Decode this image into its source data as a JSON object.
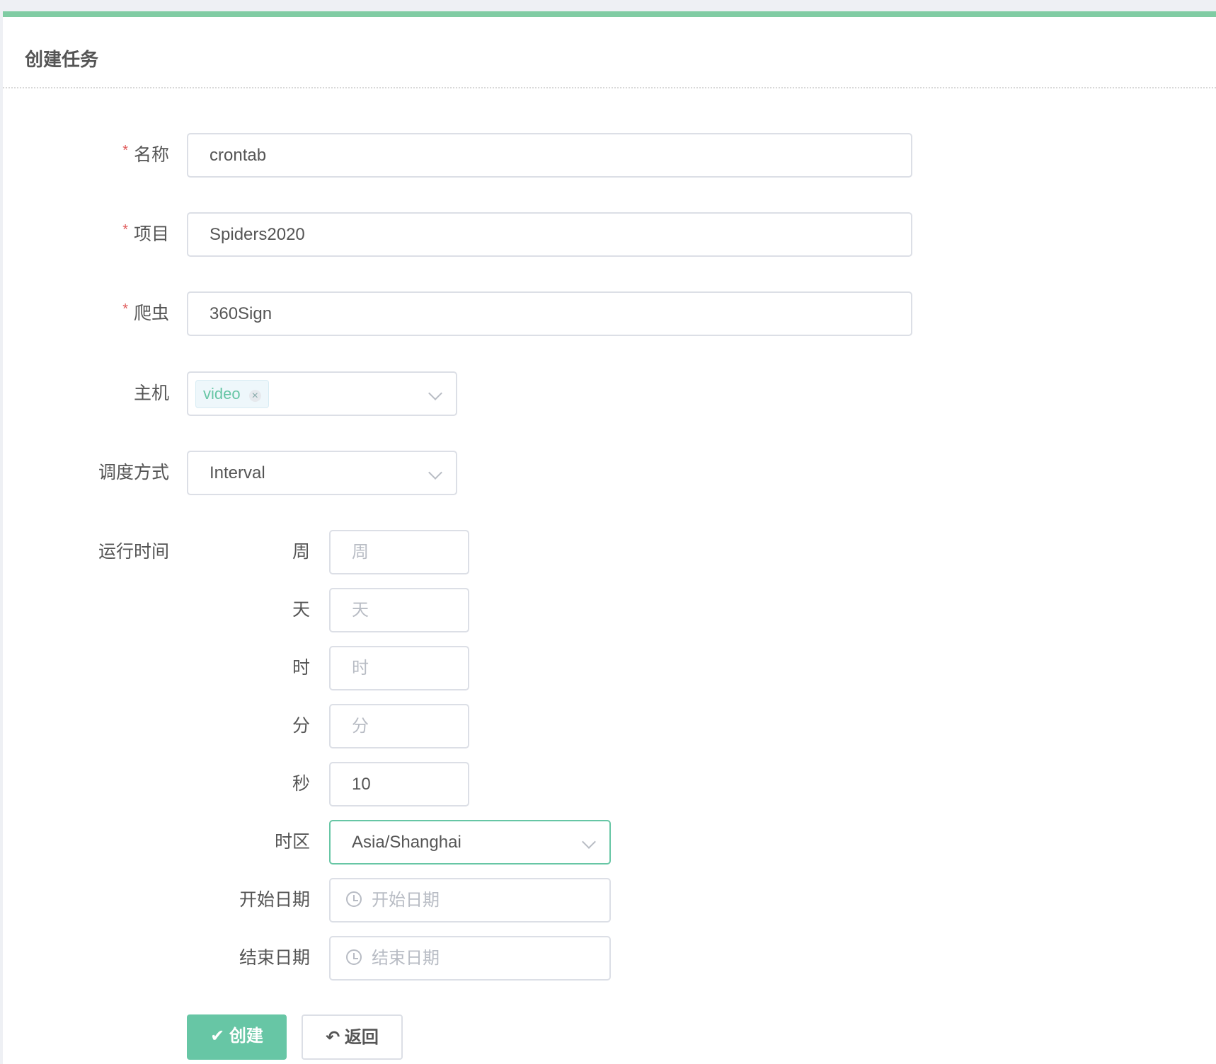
{
  "title": "创建任务",
  "accent": "#67c6a5",
  "fields": {
    "name": {
      "label": "名称",
      "value": "crontab",
      "required": true
    },
    "project": {
      "label": "项目",
      "value": "Spiders2020",
      "required": true
    },
    "spider": {
      "label": "爬虫",
      "value": "360Sign",
      "required": true
    },
    "host": {
      "label": "主机",
      "tags": [
        "video"
      ]
    },
    "schedule": {
      "label": "调度方式",
      "value": "Interval"
    },
    "runtime": {
      "label": "运行时间",
      "week": {
        "label": "周",
        "placeholder": "周"
      },
      "day": {
        "label": "天",
        "placeholder": "天"
      },
      "hour": {
        "label": "时",
        "placeholder": "时"
      },
      "minute": {
        "label": "分",
        "placeholder": "分"
      },
      "second": {
        "label": "秒",
        "value": "10"
      },
      "timezone": {
        "label": "时区",
        "value": "Asia/Shanghai"
      },
      "start_date": {
        "label": "开始日期",
        "placeholder": "开始日期"
      },
      "end_date": {
        "label": "结束日期",
        "placeholder": "结束日期"
      }
    }
  },
  "buttons": {
    "create": "创建",
    "back": "返回"
  },
  "icons": {
    "required": "*",
    "tag_close": "×",
    "check": "✔",
    "back": "↶"
  }
}
